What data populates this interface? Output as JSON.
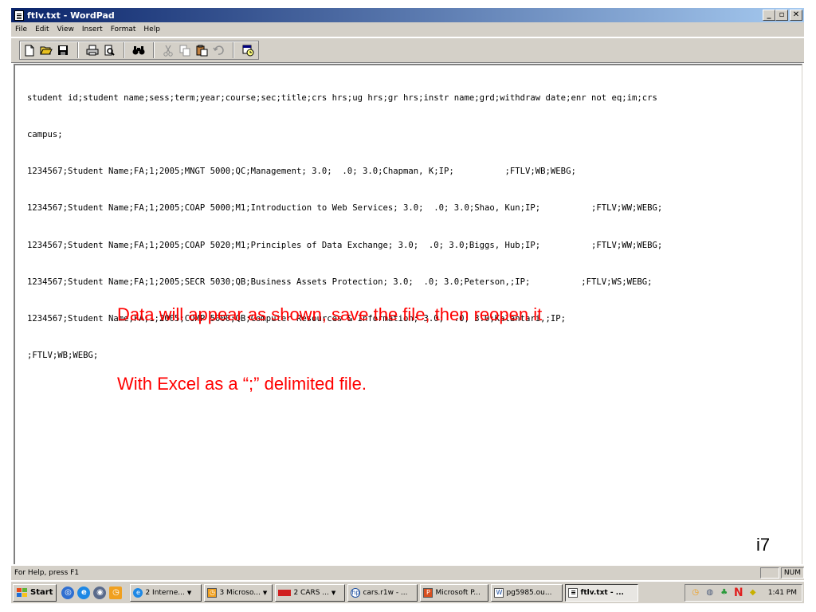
{
  "window": {
    "title": "ftlv.txt - WordPad",
    "buttons": {
      "minimize": "_",
      "maximize": "▫",
      "close": "✕"
    }
  },
  "menu": [
    "File",
    "Edit",
    "View",
    "Insert",
    "Format",
    "Help"
  ],
  "toolbar": {
    "buttons": [
      "new-icon",
      "open-icon",
      "save-icon",
      "print-icon",
      "print-preview-icon",
      "find-icon",
      "cut-icon",
      "copy-icon",
      "paste-icon",
      "undo-icon",
      "date-time-icon"
    ]
  },
  "document": {
    "lines": [
      "student id;student name;sess;term;year;course;sec;title;crs hrs;ug hrs;gr hrs;instr name;grd;withdraw date;enr not eq;im;crs",
      "campus;",
      "1234567;Student Name;FA;1;2005;MNGT 5000;QC;Management; 3.0;  .0; 3.0;Chapman, K;IP;          ;FTLV;WB;WEBG;",
      "1234567;Student Name;FA;1;2005;COAP 5000;M1;Introduction to Web Services; 3.0;  .0; 3.0;Shao, Kun;IP;          ;FTLV;WW;WEBG;",
      "1234567;Student Name;FA;1;2005;COAP 5020;M1;Principles of Data Exchange; 3.0;  .0; 3.0;Biggs, Hub;IP;          ;FTLV;WW;WEBG;",
      "1234567;Student Name;FA;1;2005;SECR 5030;QB;Business Assets Protection; 3.0;  .0; 3.0;Peterson,;IP;          ;FTLV;WS;WEBG;",
      "1234567;Student Name;FA;1;2005;COMP 5000;QB;Computer Resources & Information; 3.0;  .0; 3.0;Kalantari,;IP;",
      ";FTLV;WB;WEBG;"
    ]
  },
  "annotation": {
    "line1": "Data will appear as shown, save the file, then reopen it",
    "line2": "With Excel as a “;” delimited file.",
    "color": "#ff0000"
  },
  "slide_number": "i7",
  "status": {
    "help_text": "For Help, press F1",
    "num": "NUM"
  },
  "taskbar": {
    "start_label": "Start",
    "tasks": [
      {
        "label": "2 Interne...",
        "icon": "ie-icon",
        "dropdown": true
      },
      {
        "label": "3 Microso...",
        "icon": "outlook-icon",
        "dropdown": true
      },
      {
        "label": "2 CARS ...",
        "icon": "cars-icon",
        "dropdown": true
      },
      {
        "label": "cars.r1w - ...",
        "icon": "hp-icon",
        "dropdown": false
      },
      {
        "label": "Microsoft P...",
        "icon": "powerpoint-icon",
        "dropdown": false
      },
      {
        "label": "pg5985.ou...",
        "icon": "document-icon",
        "dropdown": false
      },
      {
        "label": "ftlv.txt - ...",
        "icon": "wordpad-icon",
        "dropdown": false,
        "active": true
      }
    ],
    "clock": "1:41 PM"
  }
}
